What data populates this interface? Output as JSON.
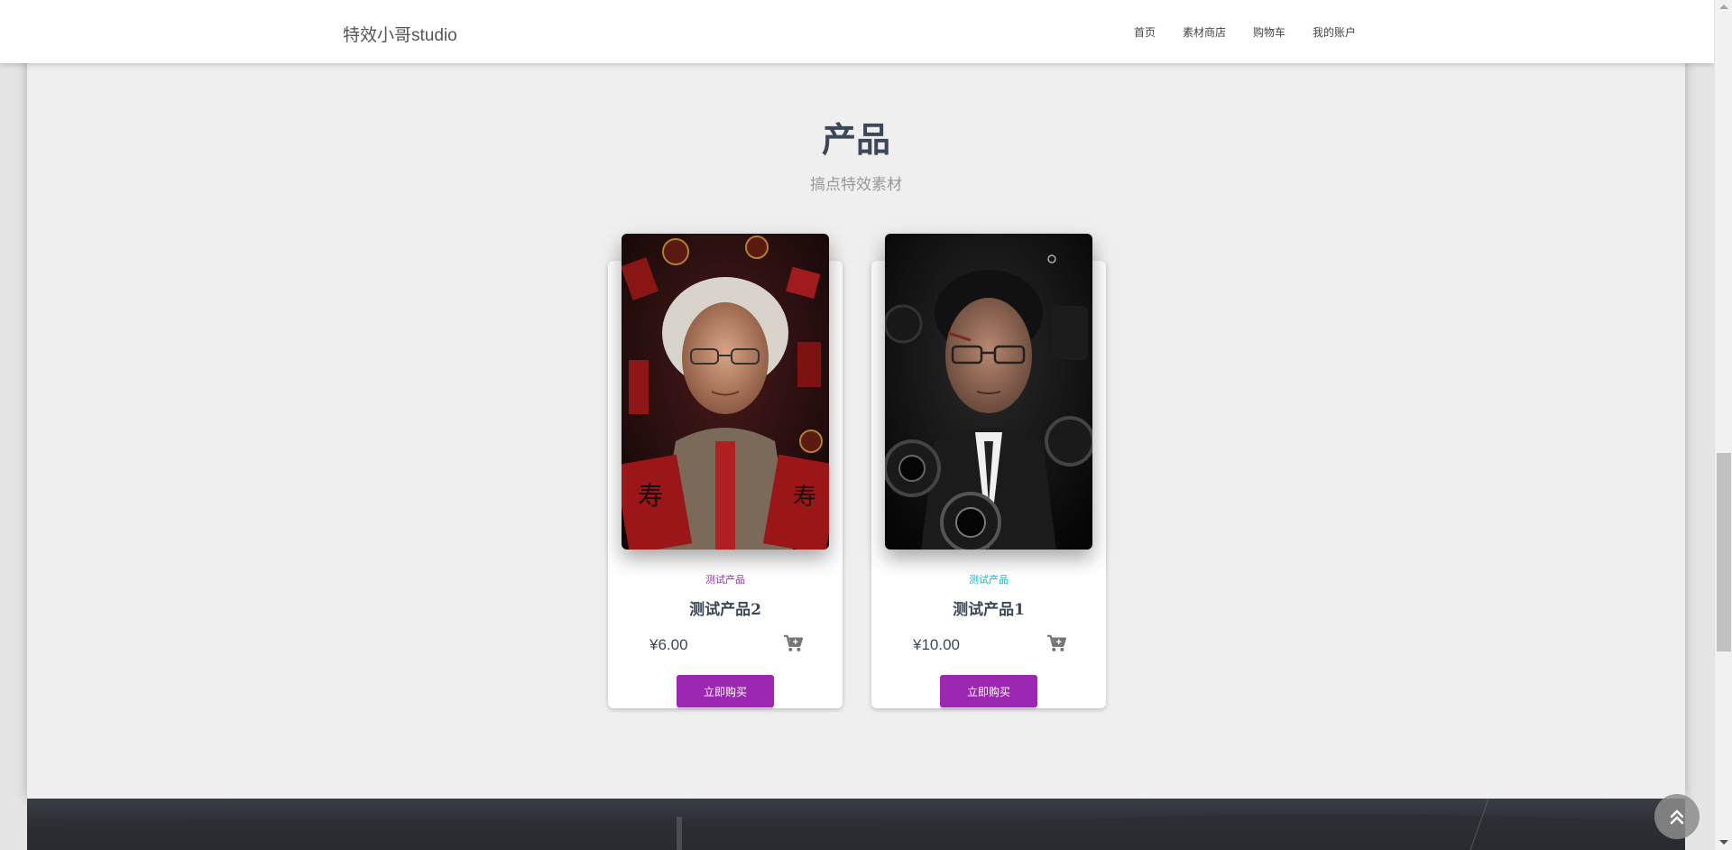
{
  "navbar": {
    "brand": "特效小哥studio",
    "links": [
      "首页",
      "素材商店",
      "购物车",
      "我的账户"
    ]
  },
  "section": {
    "title": "产品",
    "subtitle": "搞点特效素材"
  },
  "products": [
    {
      "category": "测试产品",
      "category_color": "#9c27b0",
      "name": "测试产品2",
      "price": "¥6.00",
      "button": "立即购买",
      "image_icon": "portrait-elderly-woman-red-envelopes"
    },
    {
      "category": "测试产品",
      "category_color": "#00bcd4",
      "name": "测试产品1",
      "price": "¥10.00",
      "button": "立即购买",
      "image_icon": "portrait-man-glasses-cameras"
    }
  ],
  "colors": {
    "accent": "#9c27b0",
    "heading": "#3c4858",
    "cyan": "#00bcd4"
  }
}
